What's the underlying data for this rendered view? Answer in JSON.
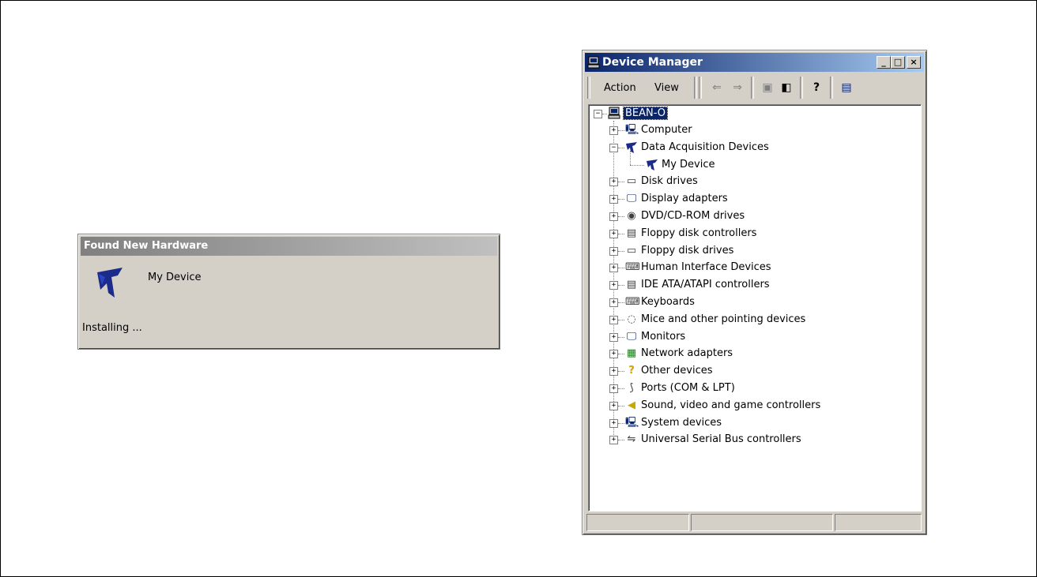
{
  "found_new_hardware": {
    "title": "Found New Hardware",
    "device_name": "My Device",
    "status": "Installing ..."
  },
  "device_manager": {
    "title": "Device Manager",
    "menu": {
      "action": "Action",
      "view": "View"
    },
    "tree": {
      "root": "BEAN-O",
      "items": [
        {
          "label": "Computer",
          "icon": "computer-icon",
          "expanded": false
        },
        {
          "label": "Data Acquisition Devices",
          "icon": "ni-logo-icon",
          "expanded": true
        },
        {
          "label": "My Device",
          "icon": "ni-logo-icon",
          "child": true
        },
        {
          "label": "Disk drives",
          "icon": "disk-drive-icon",
          "expanded": false
        },
        {
          "label": "Display adapters",
          "icon": "display-adapter-icon",
          "expanded": false
        },
        {
          "label": "DVD/CD-ROM drives",
          "icon": "cdrom-icon",
          "expanded": false
        },
        {
          "label": "Floppy disk controllers",
          "icon": "floppy-controller-icon",
          "expanded": false
        },
        {
          "label": "Floppy disk drives",
          "icon": "floppy-drive-icon",
          "expanded": false
        },
        {
          "label": "Human Interface Devices",
          "icon": "hid-icon",
          "expanded": false
        },
        {
          "label": "IDE ATA/ATAPI controllers",
          "icon": "ide-controller-icon",
          "expanded": false
        },
        {
          "label": "Keyboards",
          "icon": "keyboard-icon",
          "expanded": false
        },
        {
          "label": "Mice and other pointing devices",
          "icon": "mouse-icon",
          "expanded": false
        },
        {
          "label": "Monitors",
          "icon": "monitor-icon",
          "expanded": false
        },
        {
          "label": "Network adapters",
          "icon": "network-adapter-icon",
          "expanded": false
        },
        {
          "label": "Other devices",
          "icon": "question-icon",
          "expanded": false
        },
        {
          "label": "Ports (COM & LPT)",
          "icon": "port-icon",
          "expanded": false
        },
        {
          "label": "Sound, video and game controllers",
          "icon": "speaker-icon",
          "expanded": false
        },
        {
          "label": "System devices",
          "icon": "system-device-icon",
          "expanded": false
        },
        {
          "label": "Universal Serial Bus controllers",
          "icon": "usb-icon",
          "expanded": false
        }
      ]
    }
  },
  "colors": {
    "active_title": "#0a246a",
    "inactive_title": "#808080",
    "window_face": "#d4d0c8",
    "ni_blue": "#1a2b8c"
  }
}
